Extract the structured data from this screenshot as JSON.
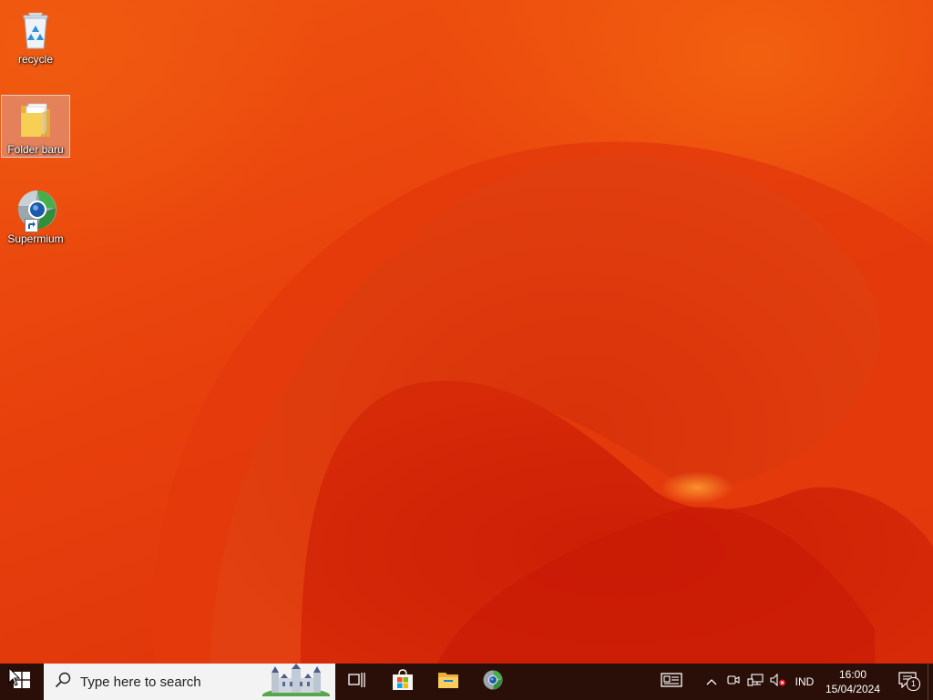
{
  "desktop": {
    "icons": [
      {
        "label": "recycle",
        "icon": "recycle-bin-icon"
      },
      {
        "label": "Folder baru",
        "icon": "folder-icon",
        "selected": true
      },
      {
        "label": "Supermium",
        "icon": "supermium-browser-icon",
        "shortcut": true
      }
    ]
  },
  "taskbar": {
    "start_icon": "windows-start-icon",
    "search": {
      "placeholder": "Type here to search",
      "icon": "search-icon"
    },
    "pinned": [
      {
        "name": "task-view",
        "icon": "task-view-icon"
      },
      {
        "name": "microsoft-store",
        "icon": "store-icon"
      },
      {
        "name": "file-explorer",
        "icon": "folder-icon"
      },
      {
        "name": "supermium",
        "icon": "supermium-browser-icon"
      }
    ],
    "tray": {
      "news_icon": "news-widget-icon",
      "chevron_icon": "chevron-up-icon",
      "meet_icon": "meet-now-icon",
      "network_icon": "network-icon",
      "volume_icon": "volume-muted-icon",
      "language": "IND",
      "time": "16:00",
      "date": "15/04/2024",
      "notifications_count": "1"
    }
  },
  "colors": {
    "wallpaper_base": "#e8420e",
    "taskbar": "#2a0f08",
    "search_bg": "#f3f3f3"
  }
}
